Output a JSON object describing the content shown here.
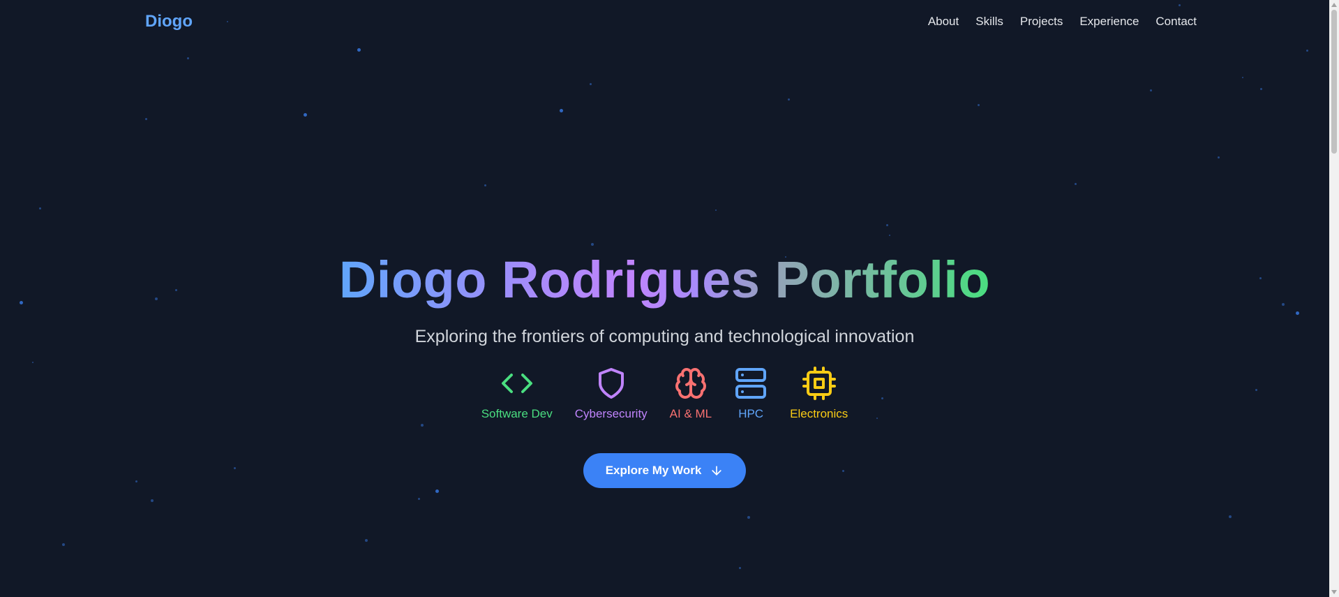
{
  "nav": {
    "logo": "Diogo",
    "links": [
      "About",
      "Skills",
      "Projects",
      "Experience",
      "Contact"
    ]
  },
  "hero": {
    "title": "Diogo Rodrigues Portfolio",
    "subtitle": "Exploring the frontiers of computing and technological innovation",
    "domains": [
      {
        "label": "Software Dev",
        "icon": "code-icon",
        "color": "#4ade80"
      },
      {
        "label": "Cybersecurity",
        "icon": "shield-icon",
        "color": "#c084fc"
      },
      {
        "label": "AI & ML",
        "icon": "brain-icon",
        "color": "#f87171"
      },
      {
        "label": "HPC",
        "icon": "server-icon",
        "color": "#60a5fa"
      },
      {
        "label": "Electronics",
        "icon": "cpu-icon",
        "color": "#facc15"
      }
    ],
    "cta": {
      "label": "Explore My Work",
      "icon": "arrow-down-icon"
    }
  },
  "colors": {
    "background": "#111827",
    "accent": "#3b82f6",
    "logo": "#60a5fa",
    "star": "#3b82f6"
  }
}
